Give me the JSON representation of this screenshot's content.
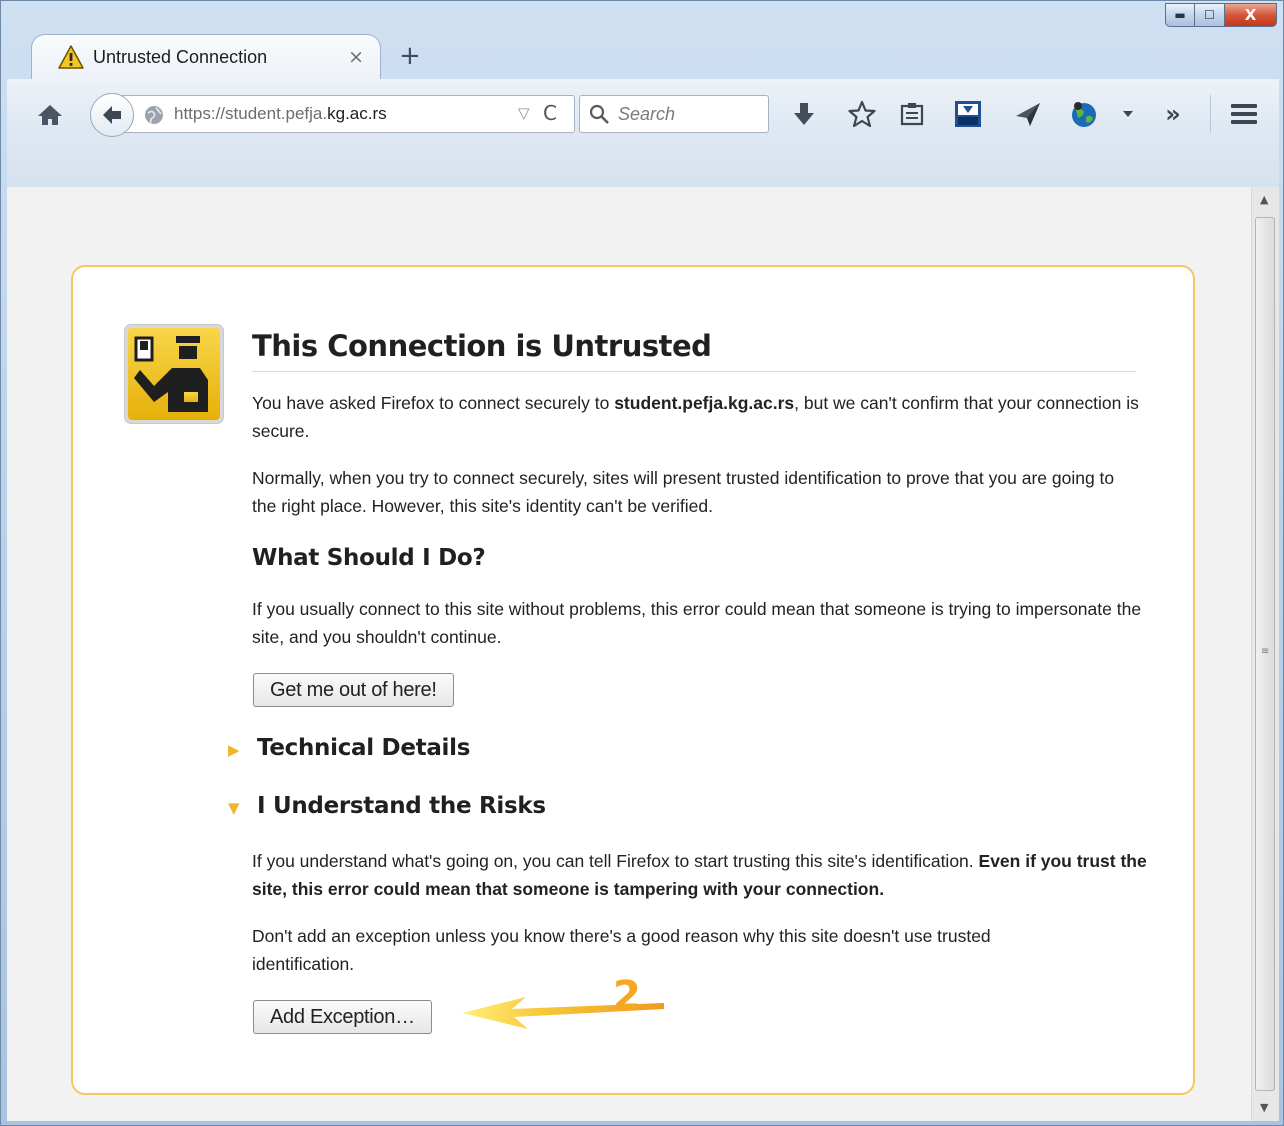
{
  "browser": {
    "tab_title": "Untrusted Connection",
    "tab_close": "×",
    "new_tab": "+",
    "window_controls": {
      "minimize": "▬",
      "maximize": "☐",
      "close": "X"
    },
    "url": {
      "prefix": "https://student.pefja.",
      "domain": "kg.ac.rs"
    },
    "url_dropdown": "▽",
    "reload": "C",
    "search_placeholder": "Search",
    "overflow": "»",
    "toolbar_icons": [
      "home-icon",
      "back-arrow-icon",
      "globe-icon",
      "reload-icon",
      "search-icon",
      "download-icon",
      "bookmark-star-icon",
      "reading-list-icon",
      "fvd-downloader-icon",
      "send-icon",
      "addon-globe-icon",
      "dropdown-icon",
      "overflow-icon",
      "menu-icon"
    ]
  },
  "error_page": {
    "title": "This Connection is Untrusted",
    "intro_before": "You have asked Firefox to connect securely to ",
    "intro_site": "student.pefja.kg.ac.rs",
    "intro_after": ", but we can't confirm that your connection is secure.",
    "normally": "Normally, when you try to connect securely, sites will present trusted identification to prove that you are going to the right place. However, this site's identity can't be verified.",
    "what_heading": "What Should I Do?",
    "what_text": "If you usually connect to this site without problems, this error could mean that someone is trying to impersonate the site, and you shouldn't continue.",
    "get_out_button": "Get me out of here!",
    "technical_heading": "Technical Details",
    "technical_marker": "▶",
    "risks_heading": "I Understand the Risks",
    "risks_marker": "▼",
    "risks_text_plain": "If you understand what's going on, you can tell Firefox to start trusting this site's identification. ",
    "risks_text_bold": "Even if you trust the site, this error could mean that someone is tampering with your connection.",
    "exception_text": "Don't add an exception unless you know there's a good reason why this site doesn't use trusted identification.",
    "add_exception_button": "Add Exception…"
  },
  "annotation": {
    "number": "2",
    "color": "#f5a623"
  },
  "scrollbar": {
    "up": "▲",
    "down": "▼",
    "grip": "≡"
  },
  "colors": {
    "box_border": "#f5c75f",
    "content_bg": "#f2f2f2",
    "icon_yellow": "#f0c01e",
    "disclosure": "#efb52c"
  }
}
